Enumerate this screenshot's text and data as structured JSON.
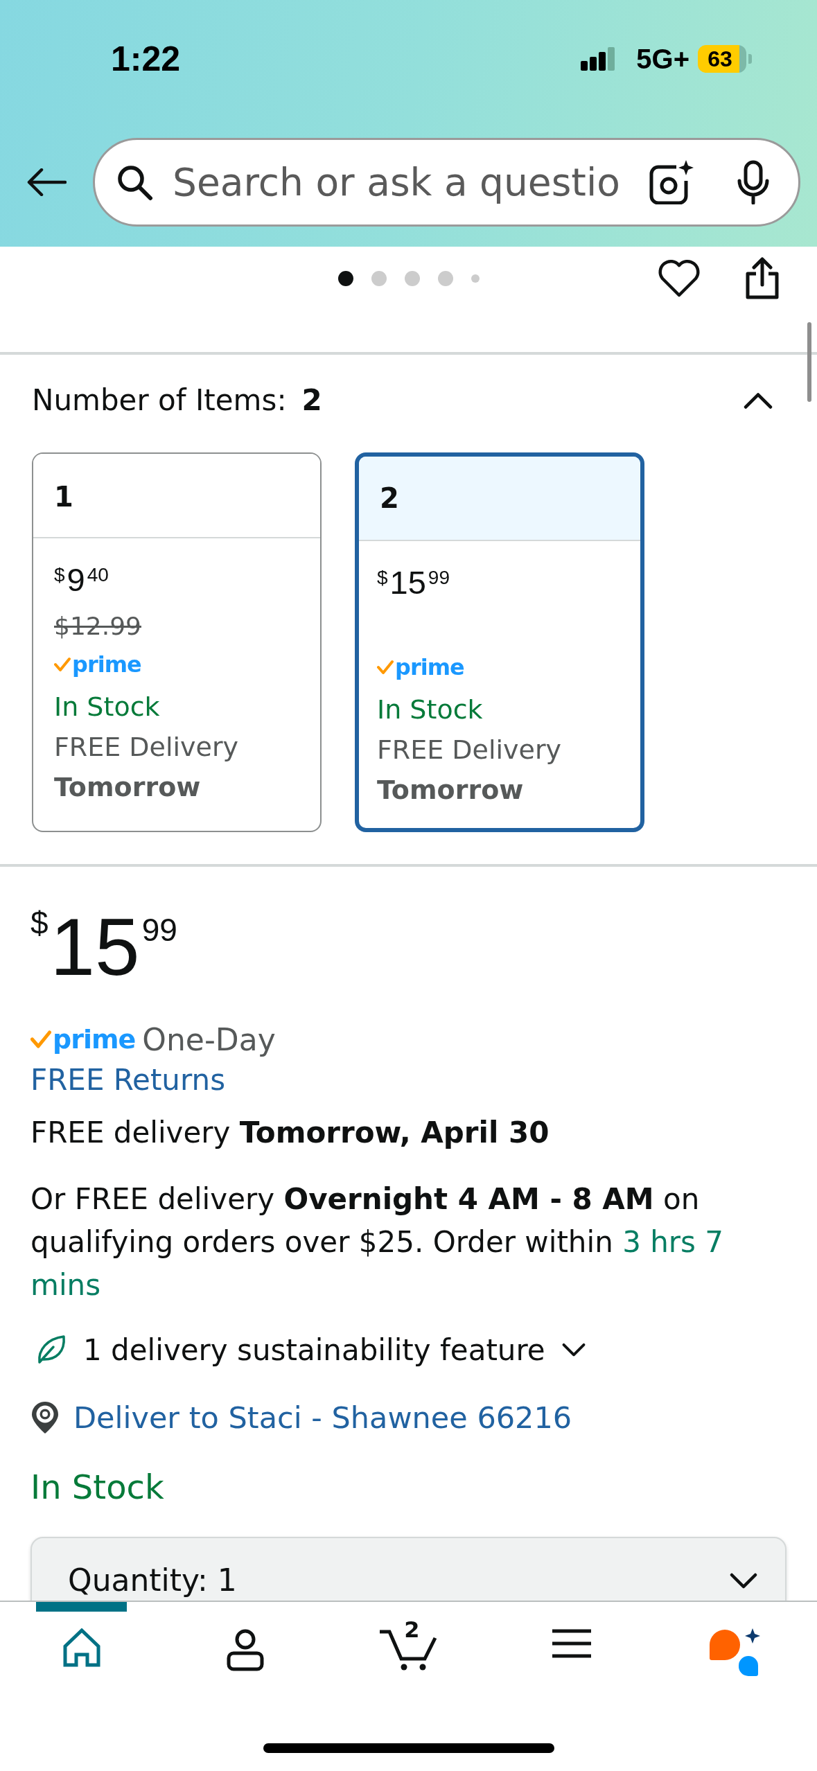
{
  "status_bar": {
    "time": "1:22",
    "network": "5G+",
    "battery": "63"
  },
  "search": {
    "placeholder": "Search or ask a questio"
  },
  "carousel": {
    "dots": [
      {
        "kind": "dot",
        "selected": true
      },
      {
        "kind": "dot",
        "selected": false
      },
      {
        "kind": "dot",
        "selected": false
      },
      {
        "kind": "dot",
        "selected": false
      },
      {
        "kind": "small",
        "selected": false
      }
    ]
  },
  "variations": {
    "label": "Number of Items:",
    "value": "2",
    "expanded": true,
    "options": [
      {
        "label": "1",
        "selected": false,
        "price": {
          "currency": "$",
          "whole": "9",
          "fraction": "40"
        },
        "list_price": "$12.99",
        "prime": "prime",
        "stock": "In Stock",
        "delivery": "FREE Delivery",
        "delivery_day": "Tomorrow"
      },
      {
        "label": "2",
        "selected": true,
        "price": {
          "currency": "$",
          "whole": "15",
          "fraction": "99"
        },
        "prime": "prime",
        "stock": "In Stock",
        "delivery": "FREE Delivery",
        "delivery_day": "Tomorrow"
      }
    ]
  },
  "offer": {
    "price": {
      "currency": "$",
      "whole": "15",
      "fraction": "99"
    },
    "prime": "prime",
    "prime_speed": "One-Day",
    "returns_link": "FREE Returns",
    "delivery": "FREE delivery **Tomorrow, April 30**",
    "fast_delivery": "Or FREE delivery **Overnight 4 AM - 8 AM** on qualifying orders over $25. Order within",
    "countdown": "3 hrs 7 mins",
    "sustainability": {
      "text": "1 delivery sustainability feature",
      "expanded": false
    },
    "deliver_to": "Deliver to Staci - Shawnee 66216",
    "stock": "In Stock",
    "quantity": {
      "label": "Quantity:",
      "value": "1"
    }
  },
  "nav": [
    {
      "kind": "home",
      "selected": true
    },
    {
      "kind": "account",
      "selected": false
    },
    {
      "kind": "cart",
      "selected": false,
      "count": "2"
    },
    {
      "kind": "menu",
      "selected": false
    },
    {
      "kind": "assistant",
      "selected": false
    }
  ]
}
